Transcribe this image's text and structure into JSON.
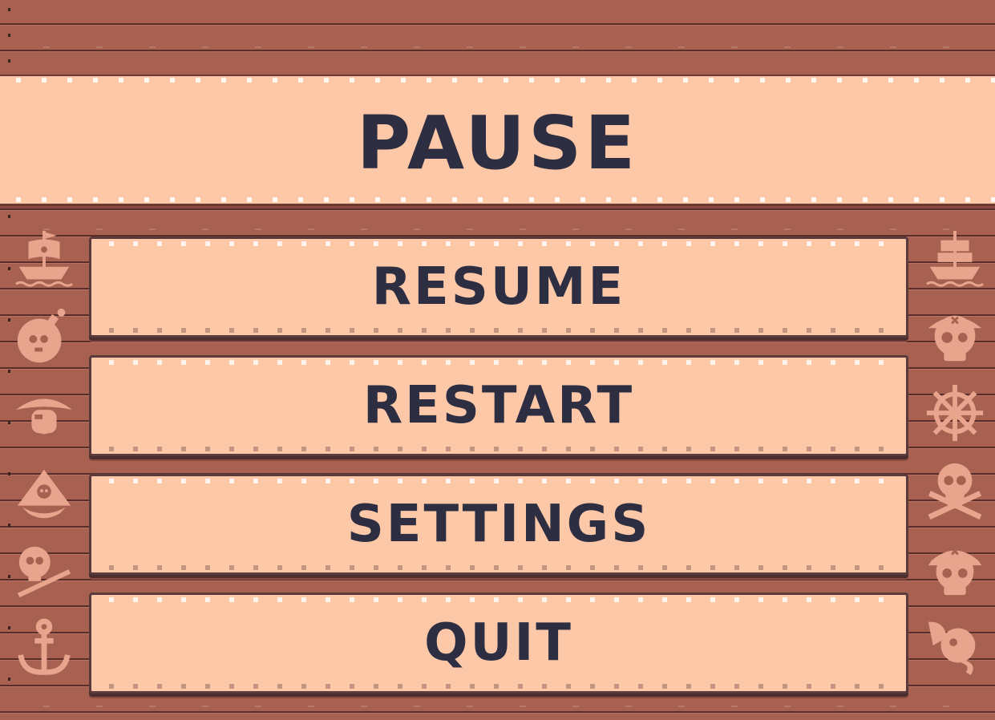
{
  "screen": {
    "title": "PAUSE"
  },
  "menu": {
    "items": [
      {
        "id": "resume",
        "label": "RESUME"
      },
      {
        "id": "restart",
        "label": "RESTART"
      },
      {
        "id": "settings",
        "label": "SETTINGS"
      },
      {
        "id": "quit",
        "label": "QUIT"
      }
    ]
  },
  "decor": {
    "left_icons": [
      "pirate-ship-icon",
      "bomb-skull-icon",
      "pirate-captain-icon",
      "pirate-hat-skull-icon",
      "skull-crossbones-icon",
      "anchor-icon"
    ],
    "right_icons": [
      "pirate-ship-icon",
      "eyepatch-skull-icon",
      "ship-wheel-icon",
      "skull-crossbones-icon",
      "bandana-skull-icon",
      "parrot-icon"
    ]
  },
  "colors": {
    "wood": "#a86150",
    "panel": "#fdc8a7",
    "text": "#2d2e42",
    "icon": "#e8a48d"
  }
}
